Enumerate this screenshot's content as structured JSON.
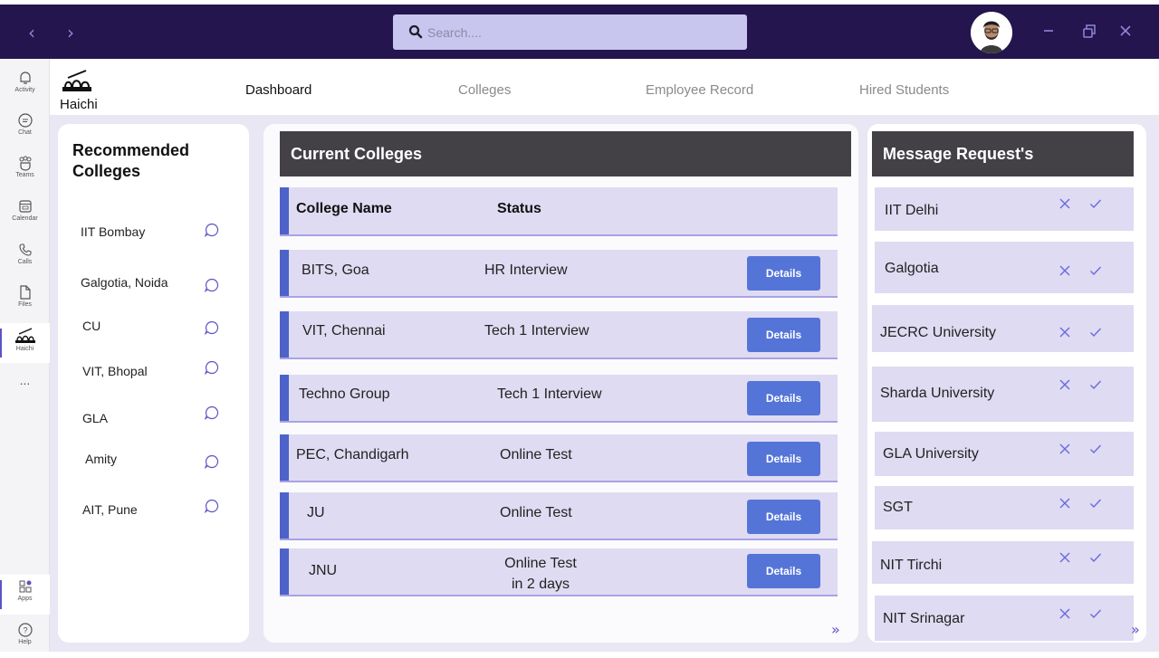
{
  "titlebar": {
    "back_icon": "chevron-left-icon",
    "forward_icon": "chevron-right-icon",
    "search_placeholder": "Search....",
    "accent": "#24154e"
  },
  "rail": {
    "items": [
      {
        "label": "Activity",
        "icon": "bell-icon"
      },
      {
        "label": "Chat",
        "icon": "chat-icon"
      },
      {
        "label": "Teams",
        "icon": "teams-icon"
      },
      {
        "label": "Calendar",
        "icon": "calendar-icon"
      },
      {
        "label": "Calls",
        "icon": "phone-icon"
      },
      {
        "label": "Files",
        "icon": "file-icon"
      },
      {
        "label": "Haichi",
        "icon": "haichi-logo-icon"
      },
      {
        "label": "...",
        "icon": "more-icon"
      }
    ],
    "bottom": [
      {
        "label": "Apps",
        "icon": "apps-icon"
      },
      {
        "label": "Help",
        "icon": "help-icon"
      }
    ]
  },
  "app": {
    "brand": "Haichi",
    "tabs": [
      "Dashboard",
      "Colleges",
      "Employee Record",
      "Hired Students"
    ],
    "active_tab": "Dashboard"
  },
  "recommended": {
    "title": "Recommended Colleges",
    "items": [
      "IIT Bombay",
      "Galgotia, Noida",
      "CU",
      "VIT, Bhopal",
      "GLA",
      "Amity",
      "AIT, Pune"
    ]
  },
  "current": {
    "title": "Current Colleges",
    "headers": {
      "name": "College Name",
      "status": "Status"
    },
    "details_label": "Details",
    "rows": [
      {
        "name": "BITS, Goa",
        "status": "HR Interview"
      },
      {
        "name": "VIT, Chennai",
        "status": "Tech 1 Interview"
      },
      {
        "name": "Techno Group",
        "status": "Tech 1 Interview"
      },
      {
        "name": "PEC, Chandigarh",
        "status": "Online Test"
      },
      {
        "name": "JU",
        "status": "Online Test"
      },
      {
        "name": "JNU",
        "status": "Online Test",
        "status_line2": "in 2 days"
      }
    ],
    "more": "»"
  },
  "messages": {
    "title": "Message Request's",
    "items": [
      "IIT Delhi",
      "Galgotia",
      "JECRC University",
      "Sharda University",
      "GLA University",
      "SGT",
      "NIT Tirchi",
      "NIT Srinagar"
    ],
    "more": "»"
  }
}
